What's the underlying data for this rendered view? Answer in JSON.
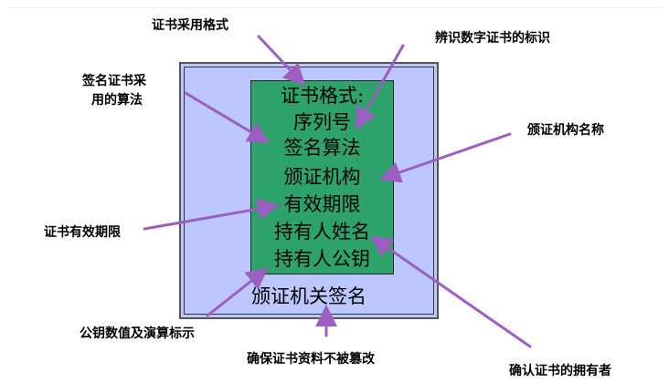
{
  "certificate": {
    "title": "证书格式:",
    "fields": [
      "序列号",
      "签名算法",
      "颁证机构",
      "有效期限",
      "持有人姓名",
      "持有人公钥"
    ],
    "signature": "颁证机关签名"
  },
  "callouts": {
    "format": "证书采用格式",
    "serial": "辨识数字证书的标识",
    "algorithm_line1": "签名证书采",
    "algorithm_line2": "用的算法",
    "issuer": "颁证机构名称",
    "validity": "证书有效期限",
    "public_key": "公钥数值及演算标示",
    "signature": "确保证书资料不被篡改",
    "holder": "确认证书的拥有者"
  },
  "colors": {
    "outer_box": "#bcc6ff",
    "certificate_box": "#2da36b",
    "arrow": "#9a5fc0"
  }
}
